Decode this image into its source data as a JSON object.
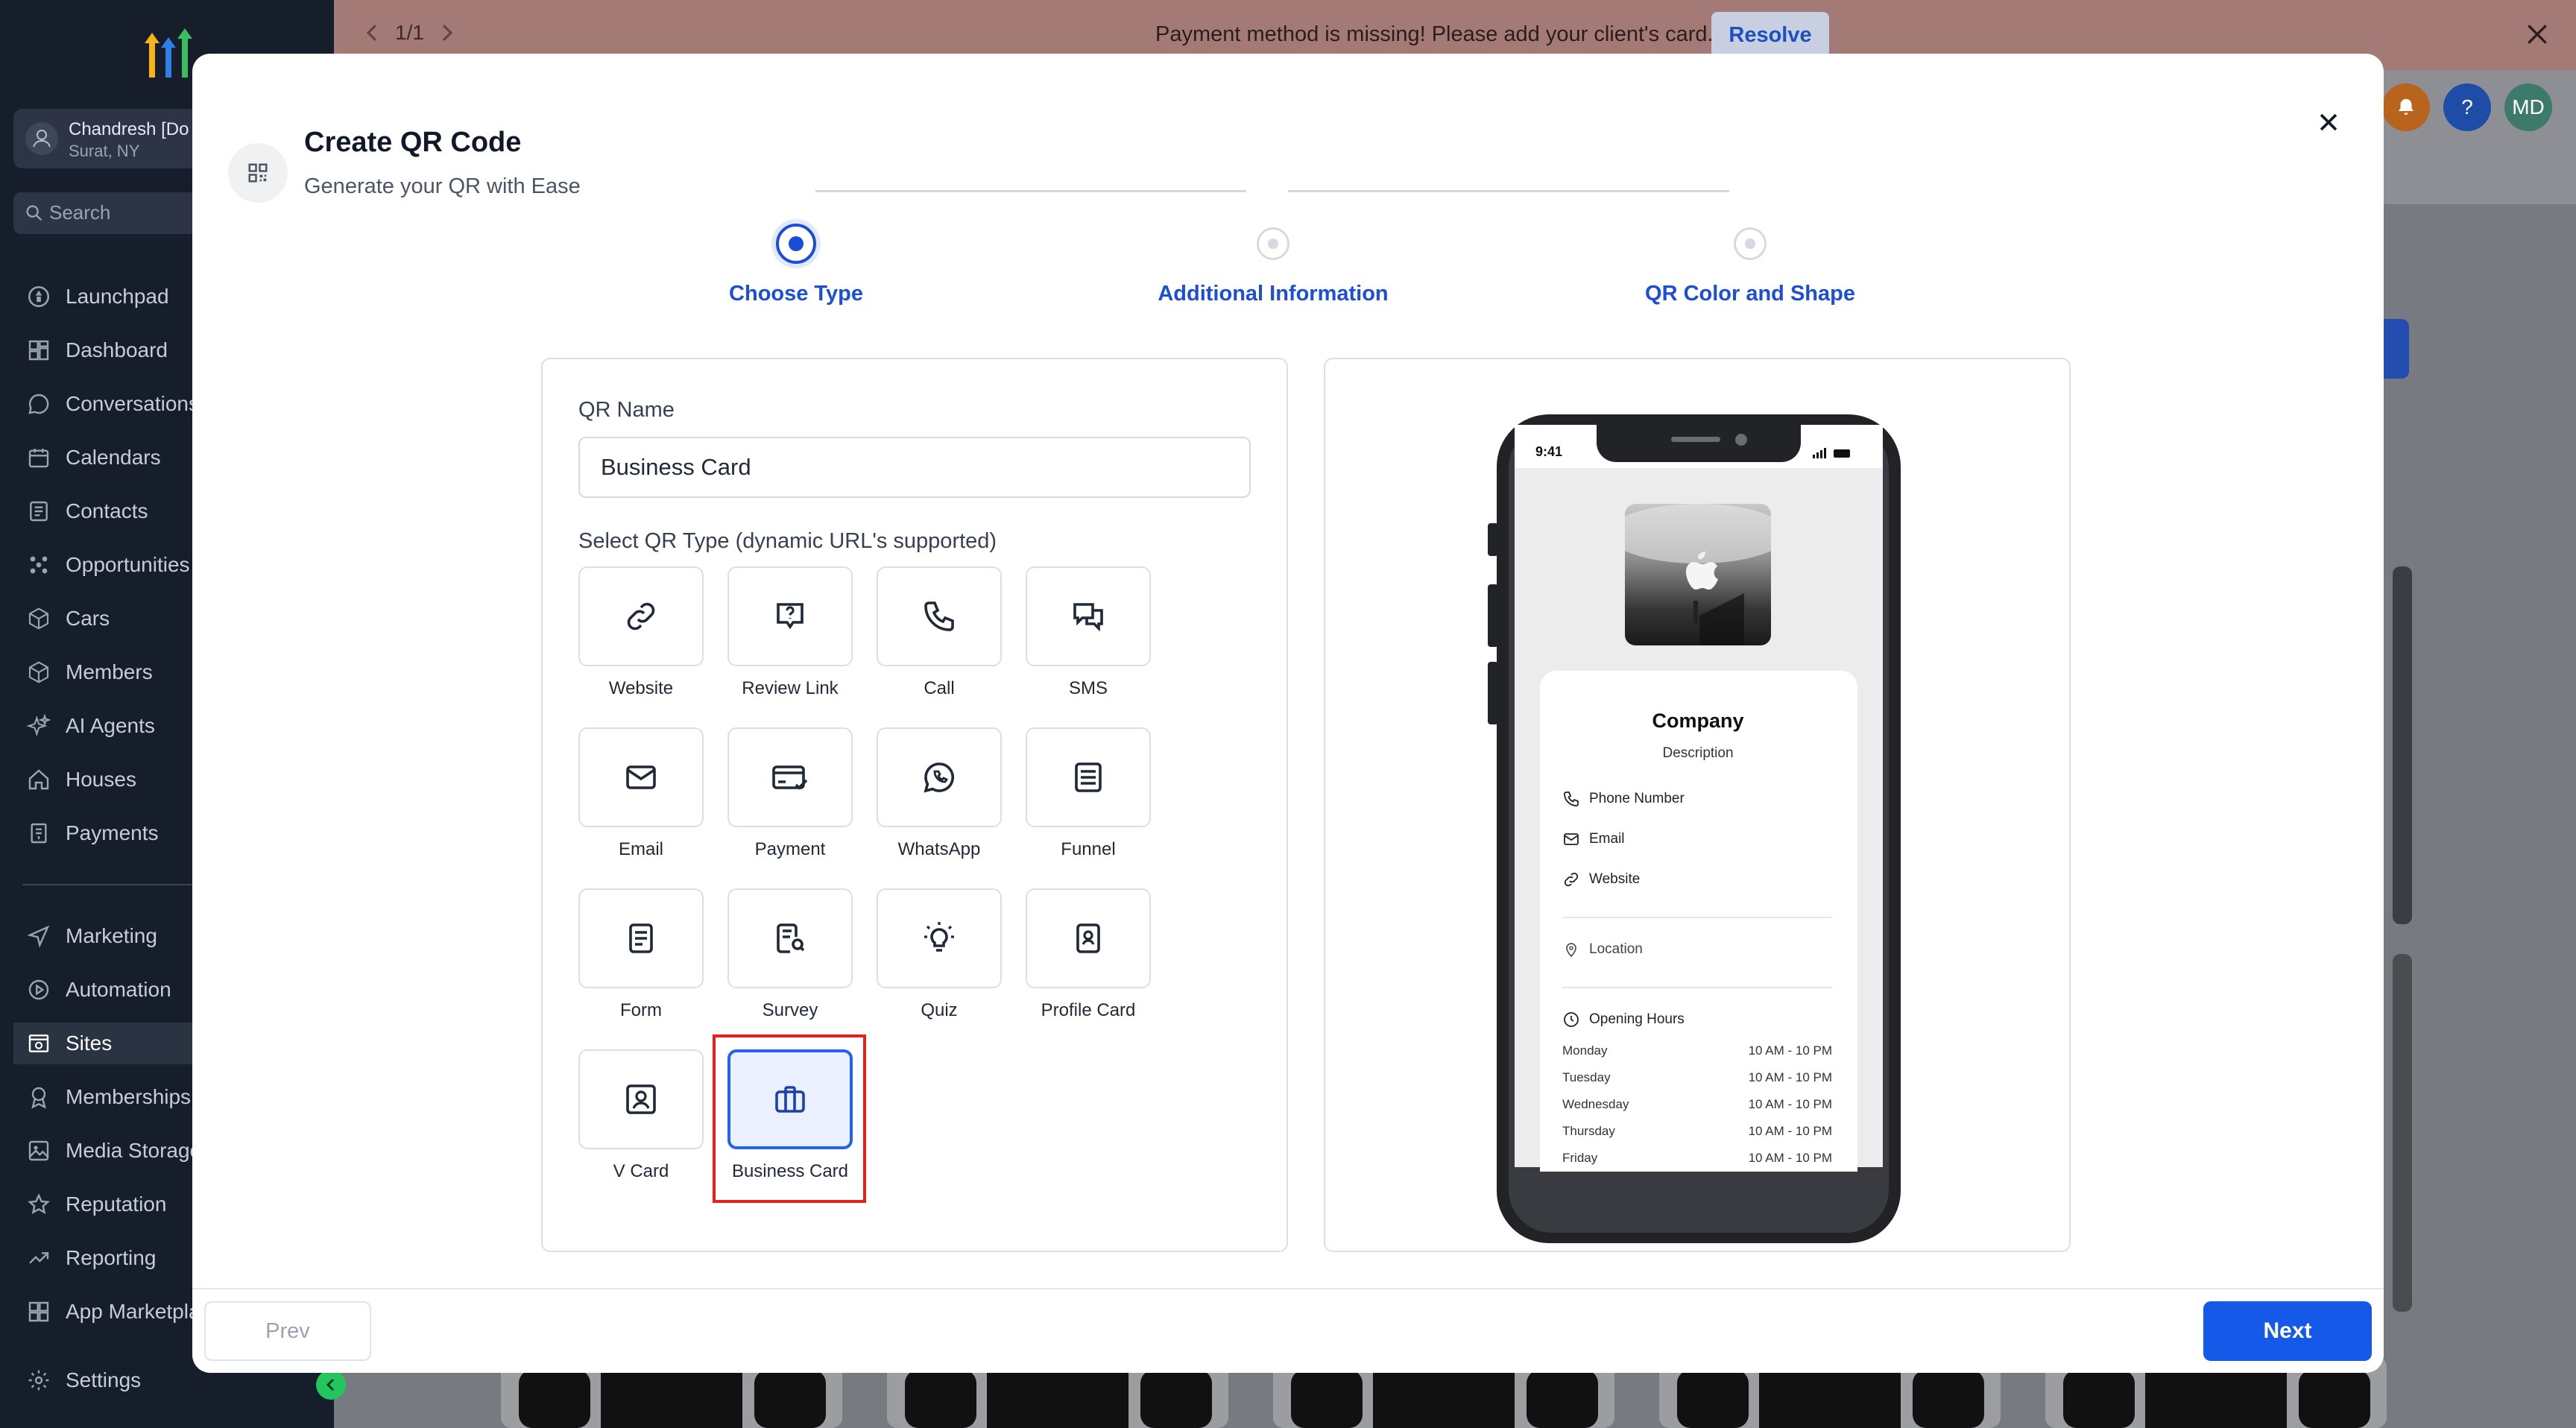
{
  "banner": {
    "pager": "1/1",
    "message": "Payment method is missing! Please add your client's card.",
    "resolve_label": "Resolve"
  },
  "sidebar": {
    "account_name": "Chandresh [Do",
    "account_location": "Surat, NY",
    "search_placeholder": "Search",
    "items": [
      {
        "label": "Launchpad",
        "icon": "rocket-icon"
      },
      {
        "label": "Dashboard",
        "icon": "grid-icon"
      },
      {
        "label": "Conversations",
        "icon": "chat-icon"
      },
      {
        "label": "Calendars",
        "icon": "calendar-icon"
      },
      {
        "label": "Contacts",
        "icon": "contacts-icon"
      },
      {
        "label": "Opportunities",
        "icon": "opportunities-icon"
      },
      {
        "label": "Cars",
        "icon": "box-icon"
      },
      {
        "label": "Members",
        "icon": "box-icon"
      },
      {
        "label": "AI Agents",
        "icon": "sparkle-icon"
      },
      {
        "label": "Houses",
        "icon": "home-icon"
      },
      {
        "label": "Payments",
        "icon": "receipt-icon"
      },
      {
        "label": "Marketing",
        "icon": "send-icon"
      },
      {
        "label": "Automation",
        "icon": "automation-icon"
      },
      {
        "label": "Sites",
        "icon": "sites-icon"
      },
      {
        "label": "Memberships",
        "icon": "badge-icon"
      },
      {
        "label": "Media Storage",
        "icon": "image-icon"
      },
      {
        "label": "Reputation",
        "icon": "star-icon"
      },
      {
        "label": "Reporting",
        "icon": "trend-icon"
      },
      {
        "label": "App Marketplace",
        "icon": "apps-icon"
      },
      {
        "label": "Settings",
        "icon": "gear-icon"
      }
    ]
  },
  "header": {
    "user_initials": "MD",
    "help": "?"
  },
  "modal": {
    "title": "Create QR Code",
    "subtitle": "Generate your QR with Ease",
    "steps": [
      {
        "label": "Choose Type",
        "active": true
      },
      {
        "label": "Additional Information",
        "active": false
      },
      {
        "label": "QR Color and Shape",
        "active": false
      }
    ],
    "qr_name_label": "QR Name",
    "qr_name_value": "Business Card",
    "qr_type_label": "Select QR Type (dynamic URL's supported)",
    "types": [
      {
        "label": "Website",
        "icon": "link-icon"
      },
      {
        "label": "Review Link",
        "icon": "review-icon"
      },
      {
        "label": "Call",
        "icon": "phone-icon"
      },
      {
        "label": "SMS",
        "icon": "sms-icon"
      },
      {
        "label": "Email",
        "icon": "mail-icon"
      },
      {
        "label": "Payment",
        "icon": "payment-card-icon"
      },
      {
        "label": "WhatsApp",
        "icon": "whatsapp-icon"
      },
      {
        "label": "Funnel",
        "icon": "funnel-icon"
      },
      {
        "label": "Form",
        "icon": "form-icon"
      },
      {
        "label": "Survey",
        "icon": "survey-icon"
      },
      {
        "label": "Quiz",
        "icon": "bulb-icon"
      },
      {
        "label": "Profile Card",
        "icon": "profile-card-icon"
      },
      {
        "label": "V Card",
        "icon": "vcard-icon"
      },
      {
        "label": "Business Card",
        "icon": "briefcase-icon"
      }
    ],
    "selected_type": "Business Card",
    "prev_label": "Prev",
    "next_label": "Next"
  },
  "preview": {
    "time": "9:41",
    "company": "Company",
    "description": "Description",
    "phone": "Phone Number",
    "email": "Email",
    "website": "Website",
    "location": "Location",
    "opening_hours_label": "Opening Hours",
    "hours": [
      {
        "day": "Monday",
        "time": "10 AM - 10 PM"
      },
      {
        "day": "Tuesday",
        "time": "10 AM - 10 PM"
      },
      {
        "day": "Wednesday",
        "time": "10 AM - 10 PM"
      },
      {
        "day": "Thursday",
        "time": "10 AM - 10 PM"
      },
      {
        "day": "Friday",
        "time": "10 AM - 10 PM"
      }
    ]
  },
  "colors": {
    "accent": "#1559e8",
    "selection_outline": "#e2231a",
    "sidebar_bg": "#161d2b"
  }
}
